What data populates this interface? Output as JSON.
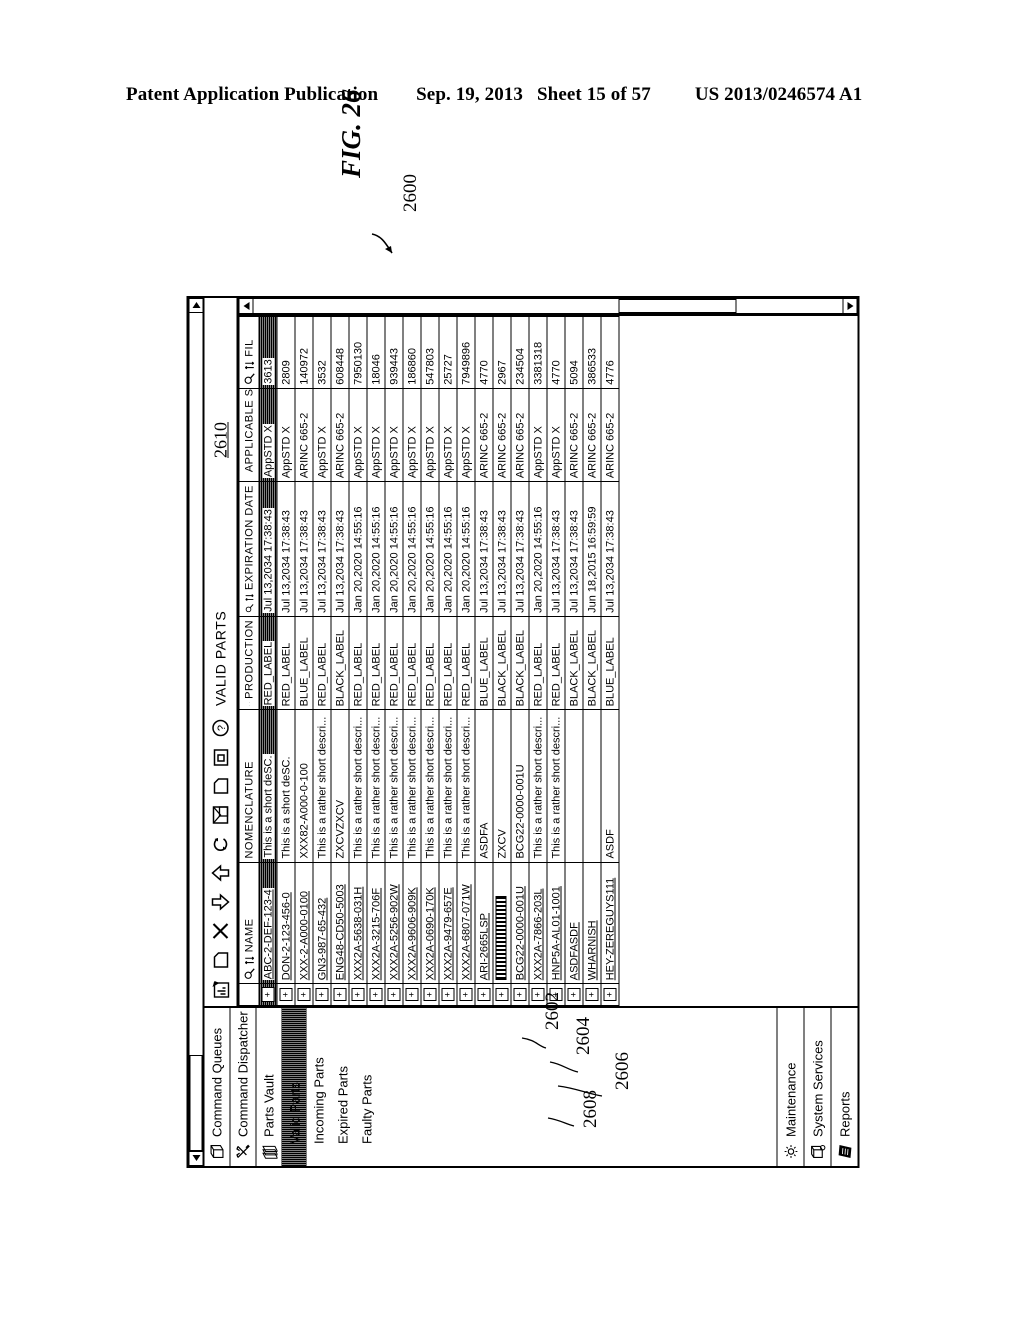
{
  "page": {
    "header": {
      "title": "Patent Application Publication",
      "date": "Sep. 19, 2013",
      "sheet": "Sheet 15 of 57",
      "publication_number": "US 2013/0246574 A1"
    },
    "figure": {
      "label": "FIG. 26",
      "ref": "2600"
    },
    "callouts": [
      {
        "id": "2602",
        "target": "Incoming Parts"
      },
      {
        "id": "2604",
        "target": "Expired Parts"
      },
      {
        "id": "2606",
        "target": "Faulty Parts"
      },
      {
        "id": "2608",
        "target": "Faulty Parts"
      },
      {
        "id": "2610",
        "target": "Valid Parts table"
      }
    ]
  },
  "app": {
    "sidebar": {
      "top_items": [
        {
          "label": "Command Queues",
          "icon": "queues-icon"
        },
        {
          "label": "Command Dispatcher",
          "icon": "dispatcher-icon"
        },
        {
          "label": "Parts Vault",
          "icon": "parts-vault-icon"
        }
      ],
      "sub_items": [
        {
          "label": "Valid Parts",
          "selected": true
        },
        {
          "label": "Incoming Parts",
          "selected": false
        },
        {
          "label": "Expired Parts",
          "selected": false
        },
        {
          "label": "Faulty Parts",
          "selected": false
        }
      ],
      "bottom_items": [
        {
          "label": "Maintenance",
          "icon": "gear-icon"
        },
        {
          "label": "System Services",
          "icon": "services-icon"
        },
        {
          "label": "Reports",
          "icon": "reports-icon"
        }
      ]
    },
    "toolbar": {
      "buttons": [
        {
          "name": "report-icon"
        },
        {
          "name": "page-icon"
        },
        {
          "name": "close-x-icon"
        },
        {
          "name": "arrow-down-icon"
        },
        {
          "name": "arrow-up-icon"
        },
        {
          "name": "refresh-icon"
        },
        {
          "name": "split-window-icon"
        },
        {
          "name": "new-page-icon"
        },
        {
          "name": "stop-square-icon"
        },
        {
          "name": "help-question-icon"
        }
      ],
      "title": "VALID PARTS",
      "ref_number": "2610"
    },
    "table": {
      "columns": [
        {
          "key": "expand",
          "label": ""
        },
        {
          "key": "name",
          "label": "NAME",
          "has_filter": true,
          "has_sort": true
        },
        {
          "key": "nomenclature",
          "label": "NOMENCLATURE",
          "has_filter": false,
          "has_sort": false
        },
        {
          "key": "production",
          "label": "PRODUCTION",
          "has_filter": true,
          "has_sort": true
        },
        {
          "key": "expiration",
          "label": "EXPIRATION DATE",
          "has_filter": true,
          "has_sort": true
        },
        {
          "key": "applicable_std",
          "label": "APPLICABLE STD",
          "has_filter": true,
          "has_sort": true
        },
        {
          "key": "fil",
          "label": "FIL",
          "has_filter": true,
          "has_sort": true
        }
      ],
      "rows": [
        {
          "selected": true,
          "name": "ABC-2-DEF-123-4",
          "nomenclature": "This is a short deSC.",
          "production": "RED_LABEL",
          "expiration": "Jul 13,2034  17:38:43",
          "applicable_std": "AppSTD X",
          "fil": "3613"
        },
        {
          "selected": false,
          "name": "DON-2-123-456-0",
          "nomenclature": "This is a short deSC.",
          "production": "RED_LABEL",
          "expiration": "Jul 13,2034  17:38:43",
          "applicable_std": "AppSTD X",
          "fil": "2809"
        },
        {
          "selected": false,
          "name": "XXX-2-A000-0100",
          "nomenclature": "XXX82-A000-0-100",
          "production": "BLUE_LABEL",
          "expiration": "Jul 13,2034  17:38:43",
          "applicable_std": "ARINC 665-2",
          "fil": "140972"
        },
        {
          "selected": false,
          "name": "GN3-987-65-432",
          "nomenclature": "This is a rather short descri...",
          "production": "RED_LABEL",
          "expiration": "Jul 13,2034  17:38:43",
          "applicable_std": "AppSTD X",
          "fil": "3532"
        },
        {
          "selected": false,
          "name": "ENG48-CD50-5003",
          "nomenclature": "ZXCVZXCV",
          "production": "BLACK_LABEL",
          "expiration": "Jul 13,2034  17:38:43",
          "applicable_std": "ARINC 665-2",
          "fil": "608448"
        },
        {
          "selected": false,
          "name": "XXX2A-5638-031H",
          "nomenclature": "This is a rather short descri...",
          "production": "RED_LABEL",
          "expiration": "Jan 20,2020  14:55:16",
          "applicable_std": "AppSTD X",
          "fil": "7950130"
        },
        {
          "selected": false,
          "name": "XXX2A-3215-706F",
          "nomenclature": "This is a rather short descri...",
          "production": "RED_LABEL",
          "expiration": "Jan 20,2020  14:55:16",
          "applicable_std": "AppSTD X",
          "fil": "18046"
        },
        {
          "selected": false,
          "name": "XXX2A-5256-902W",
          "nomenclature": "This is a rather short descri...",
          "production": "RED_LABEL",
          "expiration": "Jan 20,2020  14:55:16",
          "applicable_std": "AppSTD X",
          "fil": "939443"
        },
        {
          "selected": false,
          "name": "XXX2A-9606-909K",
          "nomenclature": "This is a rather short descri...",
          "production": "RED_LABEL",
          "expiration": "Jan 20,2020  14:55:16",
          "applicable_std": "AppSTD X",
          "fil": "186860"
        },
        {
          "selected": false,
          "name": "XXX2A-0690-170K",
          "nomenclature": "This is a rather short descri...",
          "production": "RED_LABEL",
          "expiration": "Jan 20,2020  14:55:16",
          "applicable_std": "AppSTD X",
          "fil": "547803"
        },
        {
          "selected": false,
          "name": "XXX2A-9479-657E",
          "nomenclature": "This is a rather short descri...",
          "production": "RED_LABEL",
          "expiration": "Jan 20,2020  14:55:16",
          "applicable_std": "AppSTD X",
          "fil": "25727"
        },
        {
          "selected": false,
          "name": "XXX2A-6807-071W",
          "nomenclature": "This is a rather short descri...",
          "production": "RED_LABEL",
          "expiration": "Jan 20,2020  14:55:16",
          "applicable_std": "AppSTD X",
          "fil": "7949896"
        },
        {
          "selected": false,
          "name": "ARI-2665LSP",
          "nomenclature": "ASDFA",
          "production": "BLUE_LABEL",
          "expiration": "Jul 13,2034  17:38:43",
          "applicable_std": "ARINC 665-2",
          "fil": "4770"
        },
        {
          "selected": false,
          "name": "",
          "barcode": true,
          "nomenclature": "ZXCV",
          "production": "BLACK_LABEL",
          "expiration": "Jul 13,2034  17:38:43",
          "applicable_std": "ARINC 665-2",
          "fil": "2967"
        },
        {
          "selected": false,
          "name": "BCG22-0000-001U",
          "nomenclature": "BCG22-0000-001U",
          "production": "BLACK_LABEL",
          "expiration": "Jul 13,2034  17:38:43",
          "applicable_std": "ARINC 665-2",
          "fil": "234504"
        },
        {
          "selected": false,
          "name": "XXX2A-7866-203L",
          "nomenclature": "This is a rather short descri...",
          "production": "RED_LABEL",
          "expiration": "Jan 20,2020  14:55:16",
          "applicable_std": "AppSTD X",
          "fil": "3381318"
        },
        {
          "selected": false,
          "name": "HNP5A-AL01-1001",
          "nomenclature": "This is a rather short descri...",
          "production": "RED_LABEL",
          "expiration": "Jul 13,2034  17:38:43",
          "applicable_std": "AppSTD X",
          "fil": "4770"
        },
        {
          "selected": false,
          "name": "ASDFASDF",
          "nomenclature": "",
          "production": "BLACK_LABEL",
          "expiration": "Jul 13,2034  17:38:43",
          "applicable_std": "ARINC 665-2",
          "fil": "5094"
        },
        {
          "selected": false,
          "name": "WHARNISH",
          "nomenclature": "",
          "production": "BLACK_LABEL",
          "expiration": "Jun 18,2015  16:59:59",
          "applicable_std": "ARINC 665-2",
          "fil": "386533"
        },
        {
          "selected": false,
          "name": "HEY-ZEREGUYS111",
          "nomenclature": "ASDF",
          "production": "BLUE_LABEL",
          "expiration": "Jul 13,2034  17:38:43",
          "applicable_std": "ARINC 665-2",
          "fil": "4776"
        }
      ],
      "expander_symbol": "+"
    }
  }
}
